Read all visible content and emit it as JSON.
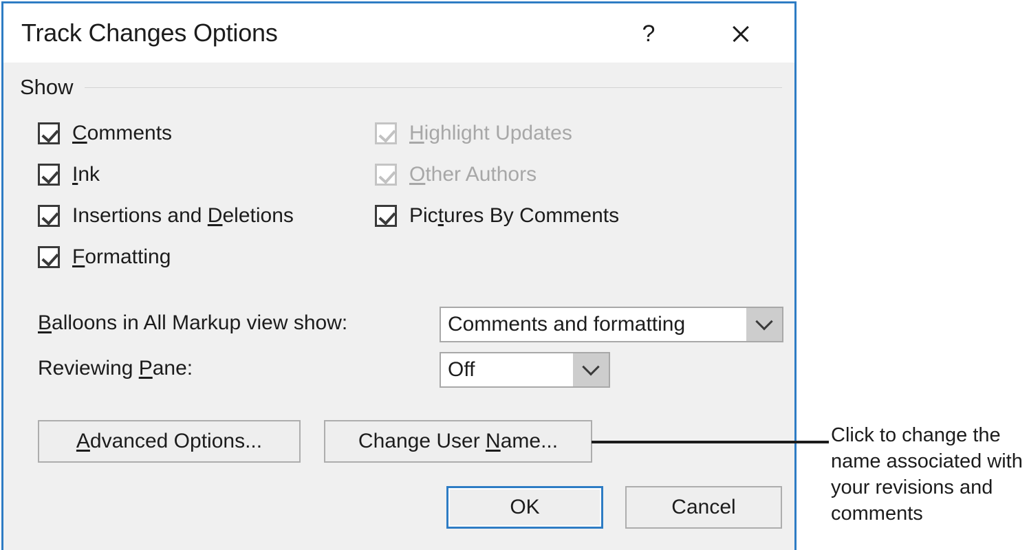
{
  "dialog": {
    "title": "Track Changes Options",
    "help_icon": "?",
    "close_icon": "close-icon",
    "group": {
      "label": "Show"
    },
    "checkboxes_left": [
      {
        "label_pre": "",
        "label_accel": "C",
        "label_post": "omments",
        "checked": true,
        "enabled": true
      },
      {
        "label_pre": "",
        "label_accel": "I",
        "label_post": "nk",
        "checked": true,
        "enabled": true
      },
      {
        "label_pre": "Insertions and ",
        "label_accel": "D",
        "label_post": "eletions",
        "checked": true,
        "enabled": true
      },
      {
        "label_pre": "",
        "label_accel": "F",
        "label_post": "ormatting",
        "checked": true,
        "enabled": true
      }
    ],
    "checkboxes_right": [
      {
        "label_pre": "",
        "label_accel": "H",
        "label_post": "ighlight Updates",
        "checked": true,
        "enabled": false
      },
      {
        "label_pre": "",
        "label_accel": "O",
        "label_post": "ther Authors",
        "checked": true,
        "enabled": false
      },
      {
        "label_pre": "Pic",
        "label_accel": "t",
        "label_post": "ures By Comments",
        "checked": true,
        "enabled": true
      }
    ],
    "fields": [
      {
        "label_pre": "",
        "label_accel": "B",
        "label_post": "alloons in All Markup view show:",
        "value": "Comments and formatting"
      },
      {
        "label_pre": "Reviewing ",
        "label_accel": "P",
        "label_post": "ane:",
        "value": "Off"
      }
    ],
    "buttons": {
      "advanced": {
        "pre": "",
        "accel": "A",
        "post": "dvanced Options..."
      },
      "change_user": {
        "pre": "Change User ",
        "accel": "N",
        "post": "ame..."
      },
      "ok": "OK",
      "cancel": "Cancel"
    }
  },
  "annotation": {
    "text": "Click to change the name associated with your revisions and comments"
  },
  "colors": {
    "accent": "#2e7cc4",
    "dialog_body": "#f0f0f0",
    "titlebar": "#ffffff",
    "disabled_text": "#a7a7a7"
  }
}
